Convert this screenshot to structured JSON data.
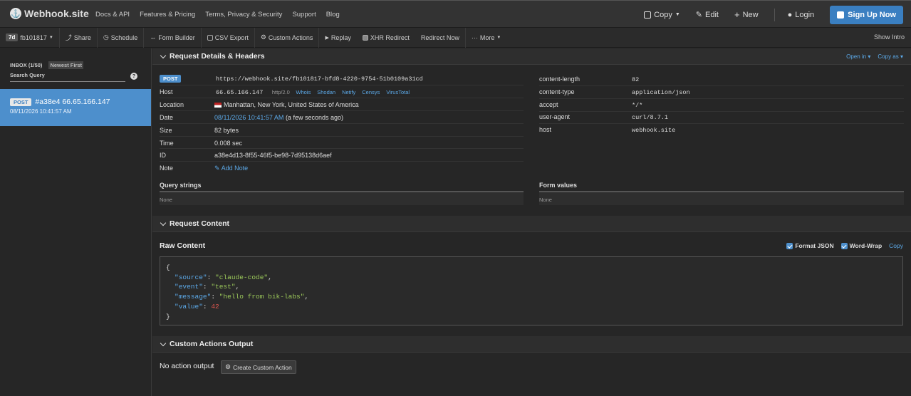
{
  "nav": {
    "brand": "Webhook.site",
    "links": [
      "Docs & API",
      "Features & Pricing",
      "Terms, Privacy & Security",
      "Support",
      "Blog"
    ],
    "copy": "Copy",
    "edit": "Edit",
    "new": "New",
    "login": "Login",
    "signup": "Sign Up Now"
  },
  "toolbar": {
    "badge": "7d",
    "token": "fb101817",
    "share": "Share",
    "schedule": "Schedule",
    "form_builder": "Form Builder",
    "csv_export": "CSV Export",
    "custom_actions": "Custom Actions",
    "replay": "Replay",
    "xhr_redirect": "XHR Redirect",
    "redirect_now": "Redirect Now",
    "more": "More",
    "show_intro": "Show Intro"
  },
  "sidebar": {
    "inbox": "INBOX (1/50)",
    "sort": "Newest First",
    "search_placeholder": "Search Query",
    "request": {
      "method": "POST",
      "summary": "#a38e4 66.65.166.147",
      "date": "08/11/2026 10:41:57 AM"
    }
  },
  "details": {
    "title": "Request Details & Headers",
    "open_in": "Open in",
    "copy_as": "Copy as",
    "method": "POST",
    "url": "https://webhook.site/fb101817-bfd8-4220-9754-51b0109a31cd",
    "host_label": "Host",
    "host_ip": "66.65.166.147",
    "http_ver": "http/2.0",
    "host_links": [
      "Whois",
      "Shodan",
      "Netify",
      "Censys",
      "VirusTotal"
    ],
    "location_label": "Location",
    "location": "Manhattan, New York, United States of America",
    "date_label": "Date",
    "date": "08/11/2026 10:41:57 AM",
    "date_rel": "(a few seconds ago)",
    "size_label": "Size",
    "size": "82 bytes",
    "time_label": "Time",
    "time": "0.008 sec",
    "id_label": "ID",
    "id": "a38e4d13-8f55-46f5-be98-7d95138d6aef",
    "note_label": "Note",
    "add_note": "Add Note",
    "headers": [
      {
        "k": "content-length",
        "v": "82"
      },
      {
        "k": "content-type",
        "v": "application/json"
      },
      {
        "k": "accept",
        "v": "*/*"
      },
      {
        "k": "user-agent",
        "v": "curl/8.7.1"
      },
      {
        "k": "host",
        "v": "webhook.site"
      }
    ],
    "query_strings": "Query strings",
    "query_none": "None",
    "form_values": "Form values",
    "form_none": "None"
  },
  "content": {
    "title": "Request Content",
    "raw": "Raw Content",
    "format_json": "Format JSON",
    "word_wrap": "Word-Wrap",
    "copy": "Copy",
    "json": [
      {
        "k": "\"source\"",
        "v": "\"claude-code\"",
        "type": "s"
      },
      {
        "k": "\"event\"",
        "v": "\"test\"",
        "type": "s"
      },
      {
        "k": "\"message\"",
        "v": "\"hello from bik-labs\"",
        "type": "s"
      },
      {
        "k": "\"value\"",
        "v": "42",
        "type": "n"
      }
    ]
  },
  "actions": {
    "title": "Custom Actions Output",
    "no_output": "No action output",
    "create": "Create Custom Action"
  }
}
